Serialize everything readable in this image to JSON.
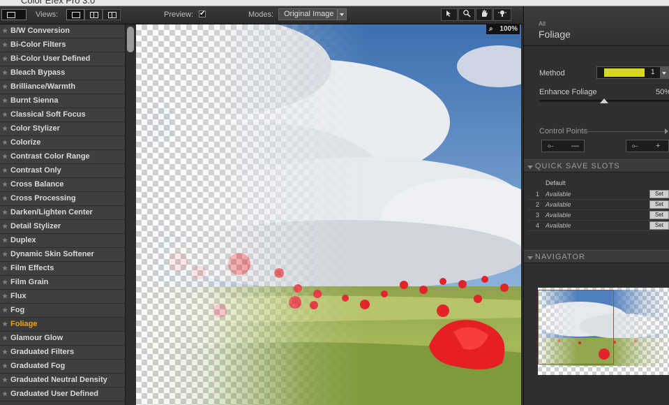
{
  "window": {
    "title": "Color Efex Pro 3.0"
  },
  "toolbar": {
    "views_label": "Views:",
    "preview_label": "Preview:",
    "preview_checked": "✔",
    "modes_label": "Modes:",
    "mode_value": "Original Image",
    "tool_icons": [
      "pointer-icon",
      "zoom-icon",
      "hand-icon",
      "lightbulb-icon"
    ]
  },
  "filters": {
    "items": [
      "B/W Conversion",
      "Bi-Color Filters",
      "Bi-Color User Defined",
      "Bleach Bypass",
      "Brilliance/Warmth",
      "Burnt Sienna",
      "Classical Soft Focus",
      "Color Stylizer",
      "Colorize",
      "Contrast Color Range",
      "Contrast Only",
      "Cross Balance",
      "Cross Processing",
      "Darken/Lighten Center",
      "Detail Stylizer",
      "Duplex",
      "Dynamic Skin Softener",
      "Film Effects",
      "Film Grain",
      "Flux",
      "Fog",
      "Foliage",
      "Glamour Glow",
      "Graduated Filters",
      "Graduated Fog",
      "Graduated Neutral Density",
      "Graduated User Defined"
    ],
    "selected": "Foliage",
    "selected_color": "#f0a21a"
  },
  "canvas": {
    "zoom": "100%"
  },
  "panel": {
    "breadcrumb": "All",
    "title": "Foliage",
    "method_label": "Method",
    "method_value": "1",
    "method_swatch_color": "#d8d821",
    "enhance_label": "Enhance Foliage",
    "enhance_value": "50%",
    "enhance_fraction": 0.5,
    "control_points_label": "Control Points",
    "cp_add_label": "⟜",
    "cp_minus": "—",
    "cp_plus": "+",
    "quick_save_label": "QUICK SAVE SLOTS",
    "slots_header": "Default",
    "slots": [
      {
        "num": "1",
        "status": "Available",
        "btn": "Set"
      },
      {
        "num": "2",
        "status": "Available",
        "btn": "Set"
      },
      {
        "num": "3",
        "status": "Available",
        "btn": "Set"
      },
      {
        "num": "4",
        "status": "Available",
        "btn": "Set"
      }
    ],
    "navigator_label": "NAVIGATOR"
  },
  "colors": {
    "accent": "#f0a21a",
    "poppy": "#e2242a",
    "sky": "#3c6fb0"
  }
}
